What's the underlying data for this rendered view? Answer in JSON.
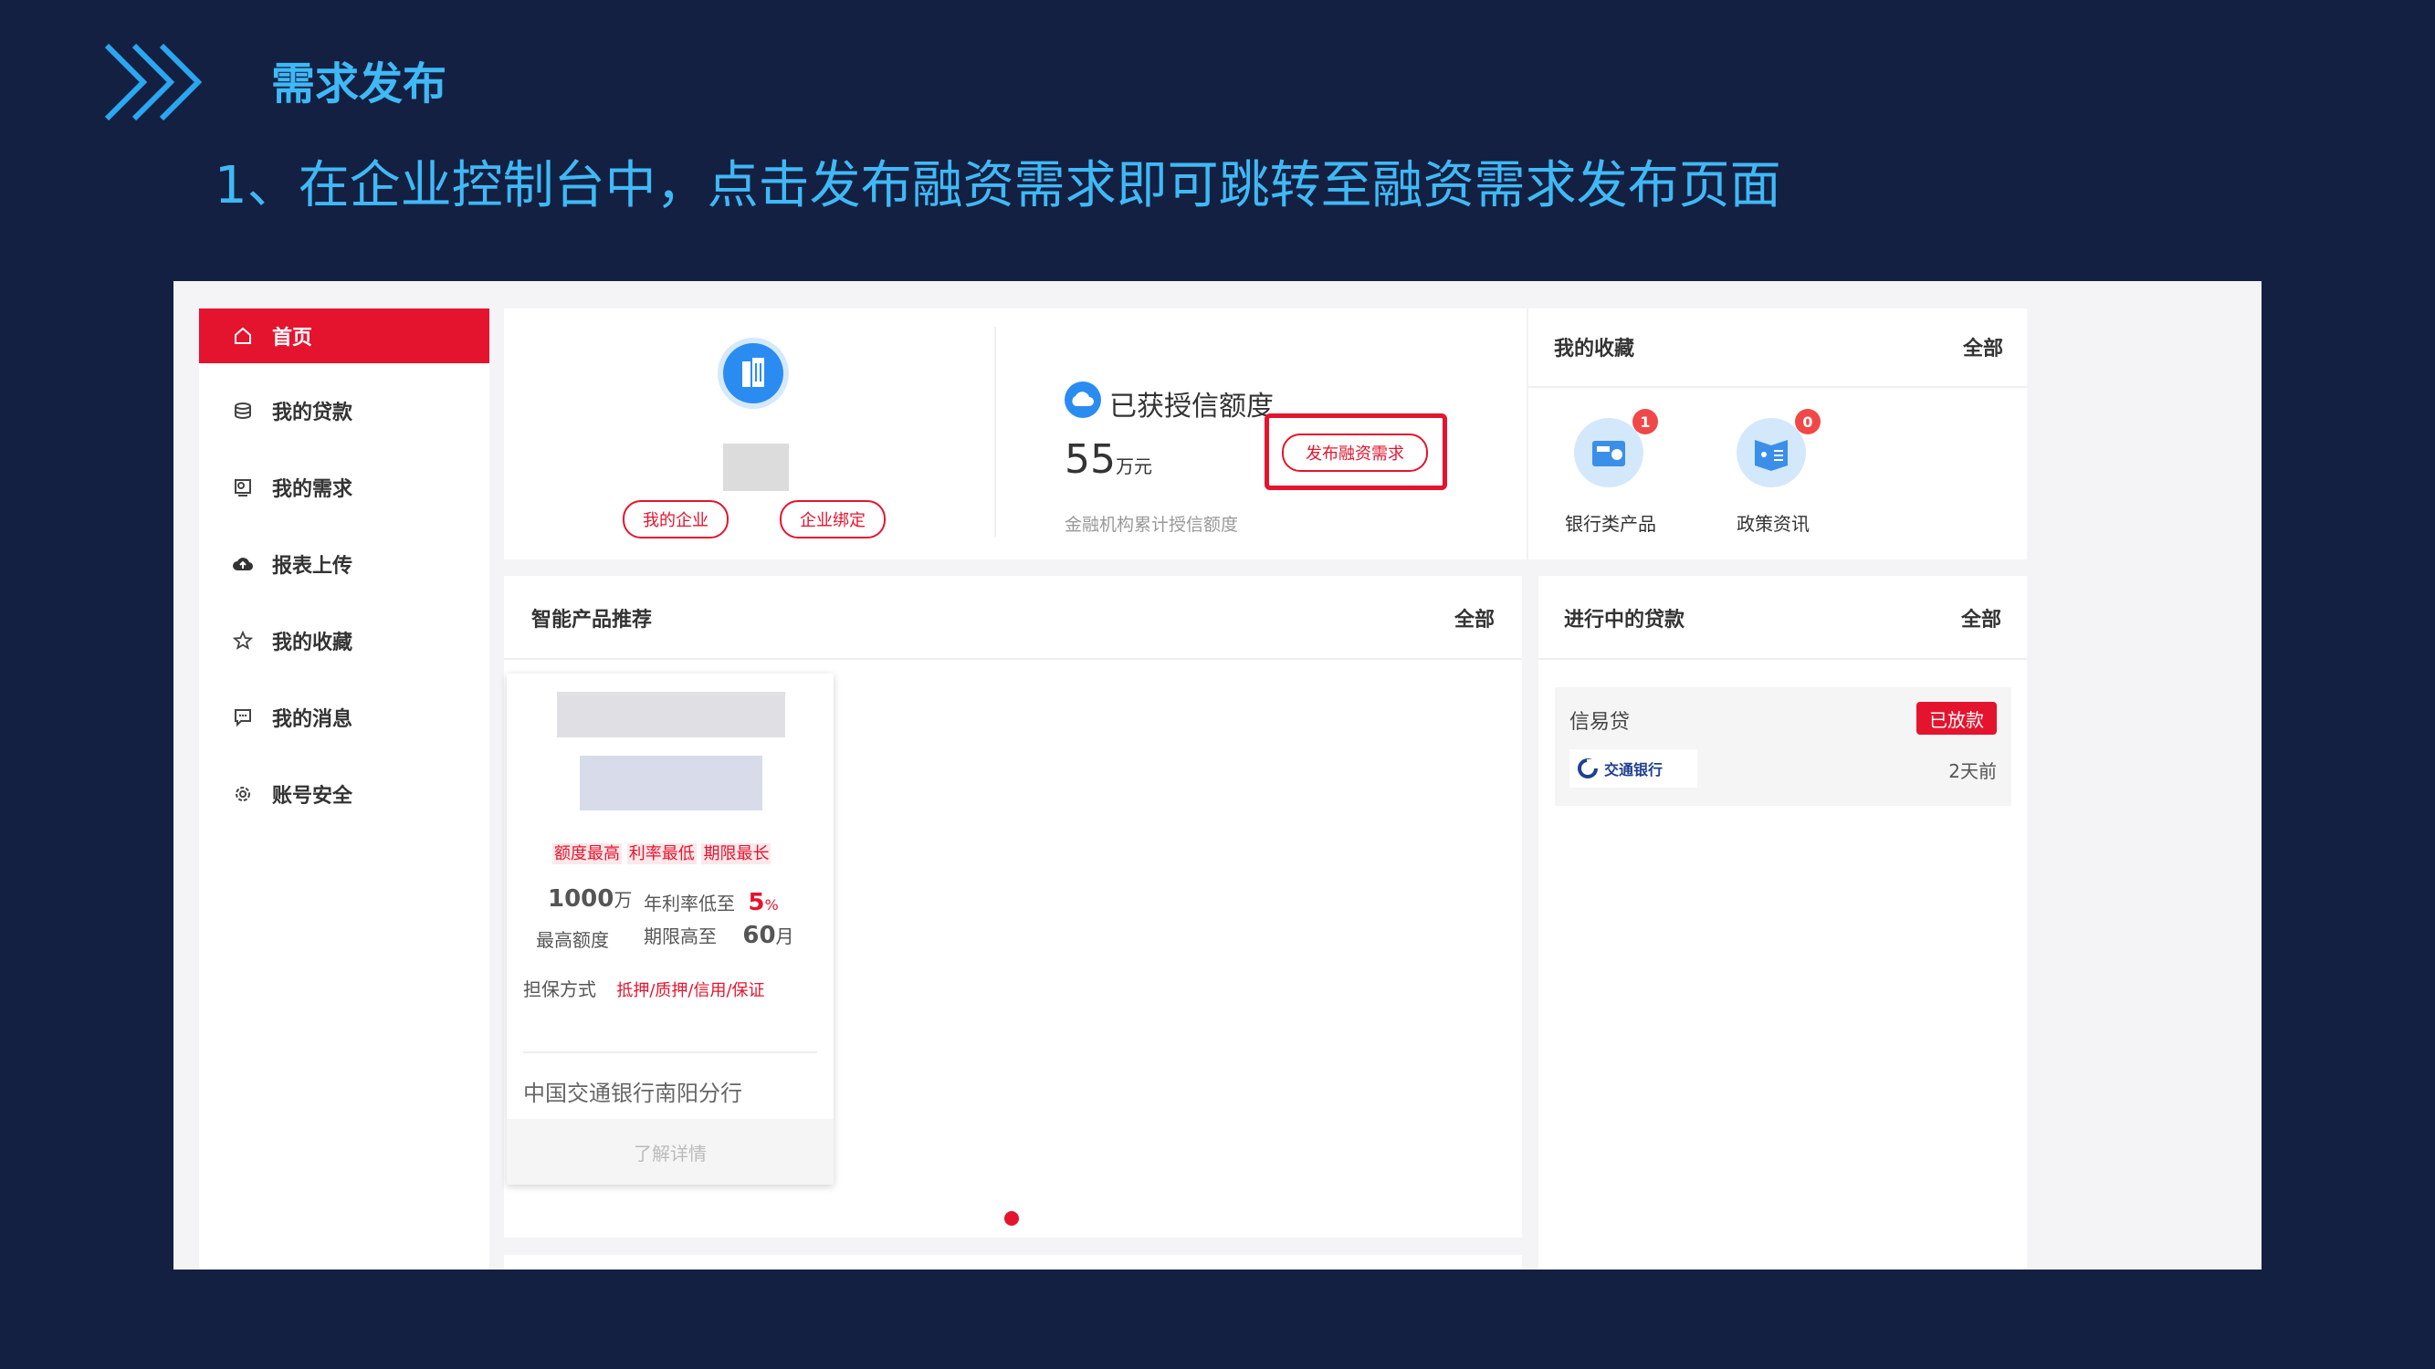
{
  "slide": {
    "title": "需求发布",
    "subtitle": "1、在企业控制台中，点击发布融资需求即可跳转至融资需求发布页面"
  },
  "sidebar": {
    "items": [
      {
        "label": "首页",
        "icon": "home-icon",
        "active": true
      },
      {
        "label": "我的贷款",
        "icon": "database-icon",
        "active": false
      },
      {
        "label": "我的需求",
        "icon": "requirement-icon",
        "active": false
      },
      {
        "label": "报表上传",
        "icon": "cloud-upload-icon",
        "active": false
      },
      {
        "label": "我的收藏",
        "icon": "star-icon",
        "active": false
      },
      {
        "label": "我的消息",
        "icon": "message-icon",
        "active": false
      },
      {
        "label": "账号安全",
        "icon": "gear-icon",
        "active": false
      }
    ]
  },
  "company": {
    "icon": "building-icon",
    "btn_my_company": "我的企业",
    "btn_bind": "企业绑定"
  },
  "credit": {
    "title": "已获授信额度",
    "amount": "55",
    "unit": "万元",
    "note": "金融机构累计授信额度",
    "publish_button": "发布融资需求"
  },
  "favorites": {
    "title": "我的收藏",
    "all": "全部",
    "items": [
      {
        "label": "银行类产品",
        "count": "1",
        "icon": "bank-product-icon"
      },
      {
        "label": "政策资讯",
        "count": "0",
        "icon": "policy-news-icon"
      }
    ]
  },
  "recommend": {
    "title": "智能产品推荐",
    "all": "全部",
    "product": {
      "tags": [
        "额度最高",
        "利率最低",
        "期限最长"
      ],
      "amount": "1000",
      "amount_unit": "万",
      "amount_label": "最高额度",
      "rate_label": "年利率低至",
      "rate": "5",
      "rate_unit": "%",
      "term_label": "期限高至",
      "term": "60",
      "term_unit": "月",
      "guarantee_label": "担保方式",
      "guarantee": "抵押/质押/信用/保证",
      "bank": "中国交通银行南阳分行",
      "detail_button": "了解详情"
    }
  },
  "loans": {
    "title": "进行中的贷款",
    "all": "全部",
    "items": [
      {
        "name": "信易贷",
        "status": "已放款",
        "bank_logo_text": "交通银行",
        "time": "2天前"
      }
    ]
  },
  "colors": {
    "accent_red": "#e5142e",
    "slide_bg": "#142042",
    "title_blue": "#3fb9f6",
    "highlight_box": "#e5142e"
  }
}
